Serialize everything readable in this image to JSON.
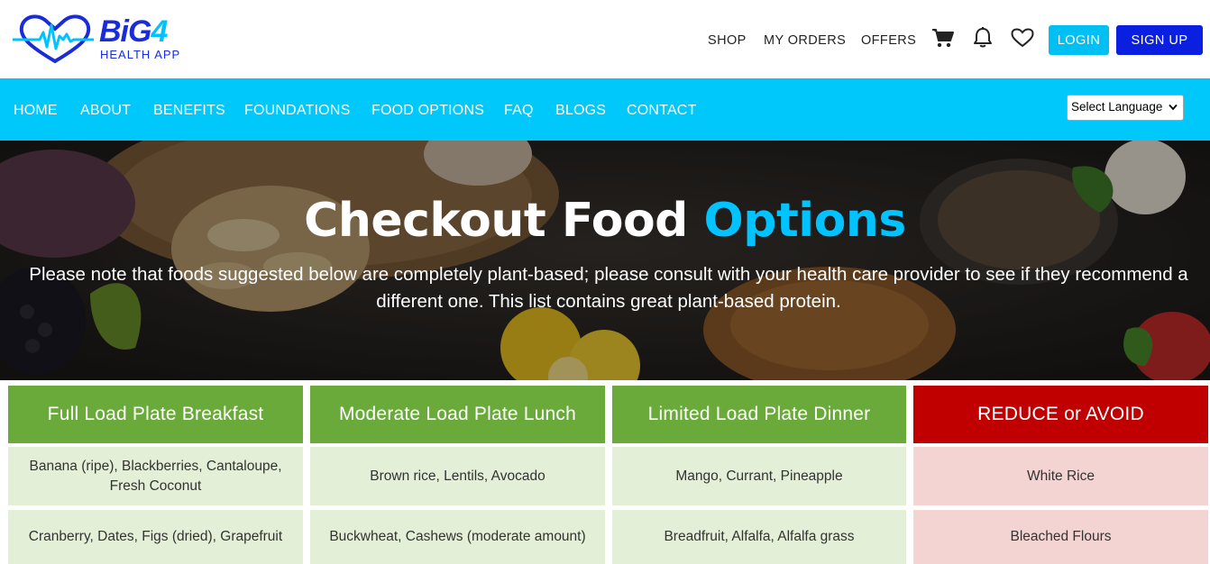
{
  "brand": {
    "name_main": "BiG",
    "name_num": "4",
    "subtitle": "HEALTH APP"
  },
  "header": {
    "links": [
      "SHOP",
      "MY ORDERS",
      "OFFERS"
    ],
    "login_label": "LOGIN",
    "signup_label": "SIGN UP"
  },
  "nav": {
    "items": [
      "HOME",
      "ABOUT",
      "BENEFITS",
      "FOUNDATIONS",
      "FOOD OPTIONS",
      "FAQ",
      "BLOGS",
      "CONTACT"
    ],
    "language_select": "Select Language"
  },
  "hero": {
    "title_main": "Checkout Food",
    "title_accent": "Options",
    "description": "Please note that foods suggested below are completely plant-based; please consult with your health care provider to see if they recommend a different one. This list contains great plant-based protein."
  },
  "food_table": {
    "columns": [
      {
        "title": "Full Load Plate Breakfast",
        "color": "#6aaa3a",
        "cell_color": "#e3efd6",
        "rows": [
          "Banana (ripe), Blackberries, Cantaloupe, Fresh Coconut",
          "Cranberry, Dates, Figs (dried), Grapefruit"
        ]
      },
      {
        "title": "Moderate Load Plate Lunch",
        "color": "#6aaa3a",
        "cell_color": "#e3efd6",
        "rows": [
          "Brown rice, Lentils, Avocado",
          "Buckwheat, Cashews (moderate amount)"
        ]
      },
      {
        "title": "Limited Load Plate Dinner",
        "color": "#6aaa3a",
        "cell_color": "#e3efd6",
        "rows": [
          "Mango, Currant, Pineapple",
          "Breadfruit, Alfalfa, Alfalfa grass"
        ]
      },
      {
        "title": "REDUCE or AVOID",
        "color": "#c00000",
        "cell_color": "#f4d3d3",
        "rows": [
          "White Rice",
          "Bleached Flours"
        ]
      }
    ]
  },
  "colors": {
    "accent_cyan": "#00c8fb",
    "brand_blue": "#0a1fe0",
    "green_header": "#6aaa3a",
    "red_header": "#c00000"
  },
  "icons": [
    "heartbeat-logo-icon",
    "cart-icon",
    "bell-icon",
    "heart-icon",
    "chevron-down-icon"
  ]
}
